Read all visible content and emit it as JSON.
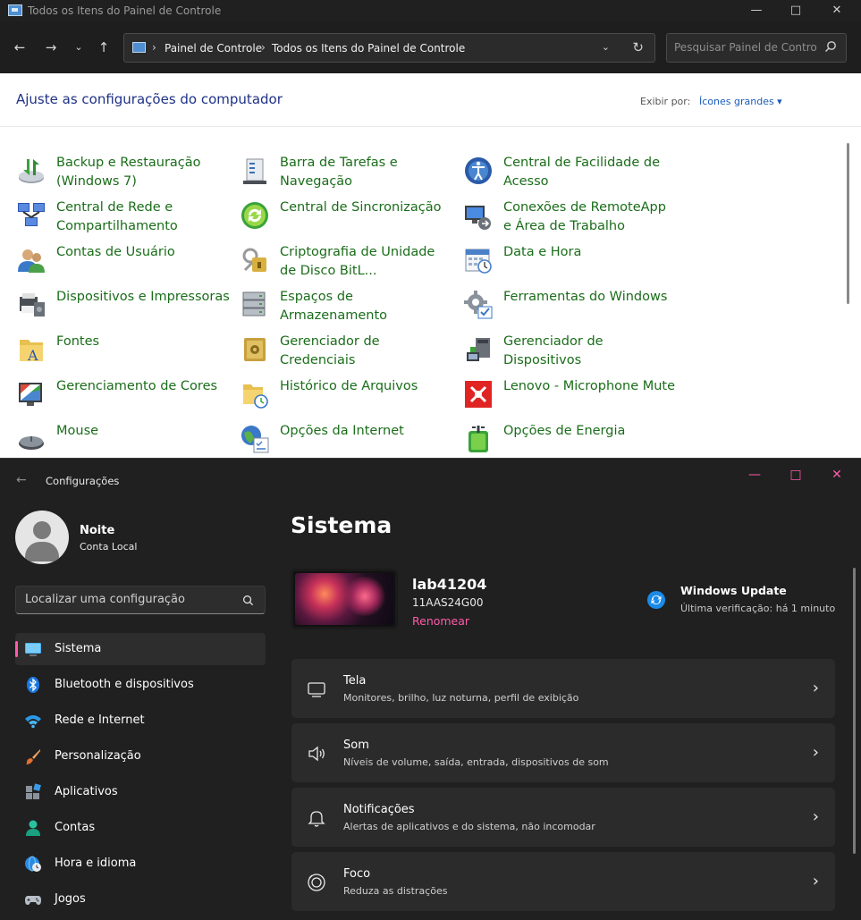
{
  "control_panel": {
    "window_title": "Todos os Itens do Painel de Controle",
    "breadcrumbs": [
      "Painel de Controle",
      "Todos os Itens do Painel de Controle"
    ],
    "search_placeholder": "Pesquisar Painel de Controle",
    "heading": "Ajuste as configurações do computador",
    "view_label": "Exibir por:",
    "view_value": "Ícones grandes",
    "items": [
      {
        "label": "Backup e Restauração (Windows 7)",
        "icon": "backup-icon"
      },
      {
        "label": "Barra de Tarefas e Navegação",
        "icon": "taskbar-icon"
      },
      {
        "label": "Central de Facilidade de Acesso",
        "icon": "ease-of-access-icon"
      },
      {
        "label": "Central de Rede e Compartilhamento",
        "icon": "network-icon"
      },
      {
        "label": "Central de Sincronização",
        "icon": "sync-icon"
      },
      {
        "label": "Conexões de RemoteApp e Área de Trabalho",
        "icon": "remoteapp-icon"
      },
      {
        "label": "Contas de Usuário",
        "icon": "user-accounts-icon"
      },
      {
        "label": "Criptografia de Unidade de Disco BitL...",
        "icon": "bitlocker-icon"
      },
      {
        "label": "Data e Hora",
        "icon": "calendar-clock-icon"
      },
      {
        "label": "Dispositivos e Impressoras",
        "icon": "printer-icon"
      },
      {
        "label": "Espaços de Armazenamento",
        "icon": "storage-spaces-icon"
      },
      {
        "label": "Ferramentas do Windows",
        "icon": "tools-gear-icon"
      },
      {
        "label": "Fontes",
        "icon": "fonts-folder-icon"
      },
      {
        "label": "Gerenciador de Credenciais",
        "icon": "credential-vault-icon"
      },
      {
        "label": "Gerenciador de Dispositivos",
        "icon": "device-manager-icon"
      },
      {
        "label": "Gerenciamento de Cores",
        "icon": "color-management-icon"
      },
      {
        "label": "Histórico de Arquivos",
        "icon": "file-history-icon"
      },
      {
        "label": "Lenovo - Microphone Mute",
        "icon": "microphone-mute-icon"
      },
      {
        "label": "Mouse",
        "icon": "mouse-icon"
      },
      {
        "label": "Opções da Internet",
        "icon": "internet-options-icon"
      },
      {
        "label": "Opções de Energia",
        "icon": "power-options-icon"
      }
    ]
  },
  "settings": {
    "app_title": "Configurações",
    "user_name": "Noite",
    "user_account": "Conta Local",
    "search_placeholder": "Localizar uma configuração",
    "nav": [
      {
        "label": "Sistema",
        "icon": "display-system-icon",
        "selected": true
      },
      {
        "label": "Bluetooth e dispositivos",
        "icon": "bluetooth-icon"
      },
      {
        "label": "Rede e Internet",
        "icon": "wifi-icon"
      },
      {
        "label": "Personalização",
        "icon": "paintbrush-icon"
      },
      {
        "label": "Aplicativos",
        "icon": "apps-icon"
      },
      {
        "label": "Contas",
        "icon": "account-icon"
      },
      {
        "label": "Hora e idioma",
        "icon": "globe-clock-icon"
      },
      {
        "label": "Jogos",
        "icon": "gamepad-icon"
      }
    ],
    "page_title": "Sistema",
    "device_name": "lab41204",
    "device_model": "11AAS24G00",
    "rename_label": "Renomear",
    "windows_update": {
      "title": "Windows Update",
      "subtitle": "Última verificação: há 1 minuto"
    },
    "cards": [
      {
        "title": "Tela",
        "subtitle": "Monitores, brilho, luz noturna, perfil de exibição",
        "icon": "monitor-icon"
      },
      {
        "title": "Som",
        "subtitle": "Níveis de volume, saída, entrada, dispositivos de som",
        "icon": "speaker-icon"
      },
      {
        "title": "Notificações",
        "subtitle": "Alertas de aplicativos e do sistema, não incomodar",
        "icon": "bell-icon"
      },
      {
        "title": "Foco",
        "subtitle": "Reduza as distrações",
        "icon": "focus-icon"
      }
    ],
    "accent_color": "#ff5aa8"
  }
}
